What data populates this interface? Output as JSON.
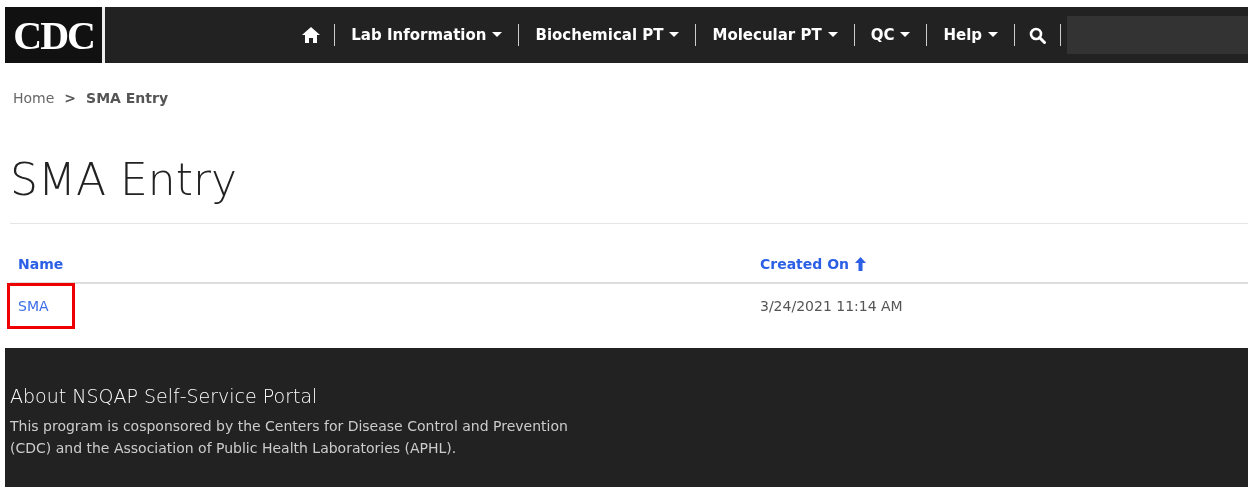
{
  "logo": {
    "text": "CDC"
  },
  "nav": {
    "items": [
      {
        "kind": "home"
      },
      {
        "kind": "menu",
        "label": "Lab Information"
      },
      {
        "kind": "menu",
        "label": "Biochemical PT"
      },
      {
        "kind": "menu",
        "label": "Molecular PT"
      },
      {
        "kind": "menu",
        "label": "QC"
      },
      {
        "kind": "menu",
        "label": "Help"
      },
      {
        "kind": "search"
      }
    ]
  },
  "breadcrumb_separator": ">",
  "breadcrumb": [
    {
      "label": "Home",
      "current": false
    },
    {
      "label": "SMA Entry",
      "current": true
    }
  ],
  "page_title": "SMA Entry",
  "table": {
    "columns": [
      {
        "label": "Name",
        "sorted": false
      },
      {
        "label": "Created On",
        "sorted": true
      }
    ],
    "rows": [
      {
        "name": "SMA",
        "created_on": "3/24/2021 11:14 AM",
        "highlighted": true
      }
    ]
  },
  "footer": {
    "title": "About NSQAP Self-Service Portal",
    "text": "This program is cosponsored by the Centers for Disease Control and Prevention (CDC) and the Association of Public Health Laboratories (APHL)."
  }
}
